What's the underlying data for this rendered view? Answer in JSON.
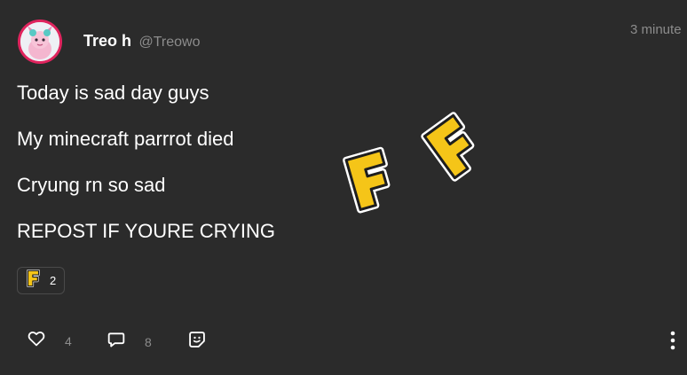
{
  "author": {
    "display_name": "Treo h",
    "handle": "@Treowo"
  },
  "timestamp": "3 minute",
  "body_lines": [
    "Today is sad day guys",
    "My minecraft parrrot died",
    "Cryung rn so sad",
    "REPOST IF YOURE CRYING"
  ],
  "stickers": [
    {
      "icon": "letter-f-sticker-icon",
      "text": "F"
    },
    {
      "icon": "letter-f-sticker-icon",
      "text": "F"
    }
  ],
  "reaction": {
    "icon": "letter-f-reaction-icon",
    "count": "2"
  },
  "actions": {
    "like": {
      "icon": "heart-icon",
      "count": "4"
    },
    "comment": {
      "icon": "comment-bubble-icon",
      "count": "8"
    },
    "sticker": {
      "icon": "sticker-icon"
    },
    "more": {
      "icon": "vertical-ellipsis-icon"
    }
  },
  "colors": {
    "background": "#2b2b2b",
    "text": "#ffffff",
    "muted": "#8c8c8c",
    "avatar_ring": "#e0245e",
    "sticker_yellow": "#f5c518"
  }
}
